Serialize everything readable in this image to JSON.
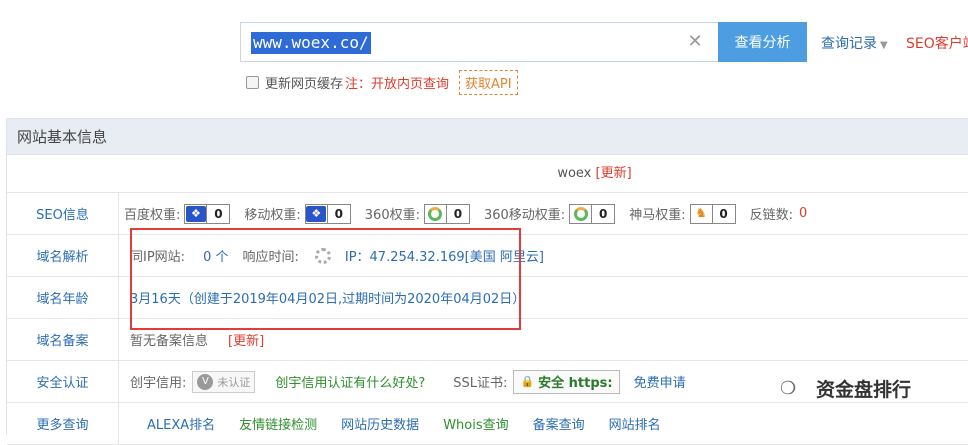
{
  "search": {
    "value": "www.woex.co/",
    "button": "查看分析",
    "history": "查询记录",
    "seo_client": "SEO客户端"
  },
  "refresh": {
    "label": "更新网页缓存",
    "note": "注：开放内页查询",
    "api": "获取API"
  },
  "panel": {
    "title": "网站基本信息",
    "site_name": "woex",
    "update": "[更新]"
  },
  "seo": {
    "label": "SEO信息",
    "baidu_label": "百度权重:",
    "baidu_value": "0",
    "mobile_label": "移动权重:",
    "mobile_value": "0",
    "s360_label": "360权重:",
    "s360_value": "0",
    "s360m_label": "360移动权重:",
    "s360m_value": "0",
    "shenma_label": "神马权重:",
    "shenma_value": "0",
    "backlinks_label": "反链数:",
    "backlinks_value": "0"
  },
  "dns": {
    "label": "域名解析",
    "same_ip_label": "同IP网站:",
    "same_ip_value": "0 个",
    "response_label": "响应时间:",
    "ip_text": "IP：47.254.32.169[美国 阿里云]"
  },
  "age": {
    "label": "域名年龄",
    "value": "3月16天（创建于2019年04月02日,过期时间为2020年04月02日）"
  },
  "icp": {
    "label": "域名备案",
    "value": "暂无备案信息",
    "update": "[更新]"
  },
  "security": {
    "label": "安全认证",
    "cert_label": "创宇信用:",
    "cert_badge": "未认证",
    "cert_link": "创宇信用认证有什么好处?",
    "ssl_label": "SSL证书:",
    "ssl_badge": "安全 https:",
    "ssl_apply": "免费申请"
  },
  "more": {
    "label": "更多查询",
    "links": [
      "ALEXA排名",
      "友情链接检测",
      "网站历史数据",
      "Whois查询",
      "备案查询",
      "网站排名"
    ]
  },
  "watermark": "资金盘排行"
}
